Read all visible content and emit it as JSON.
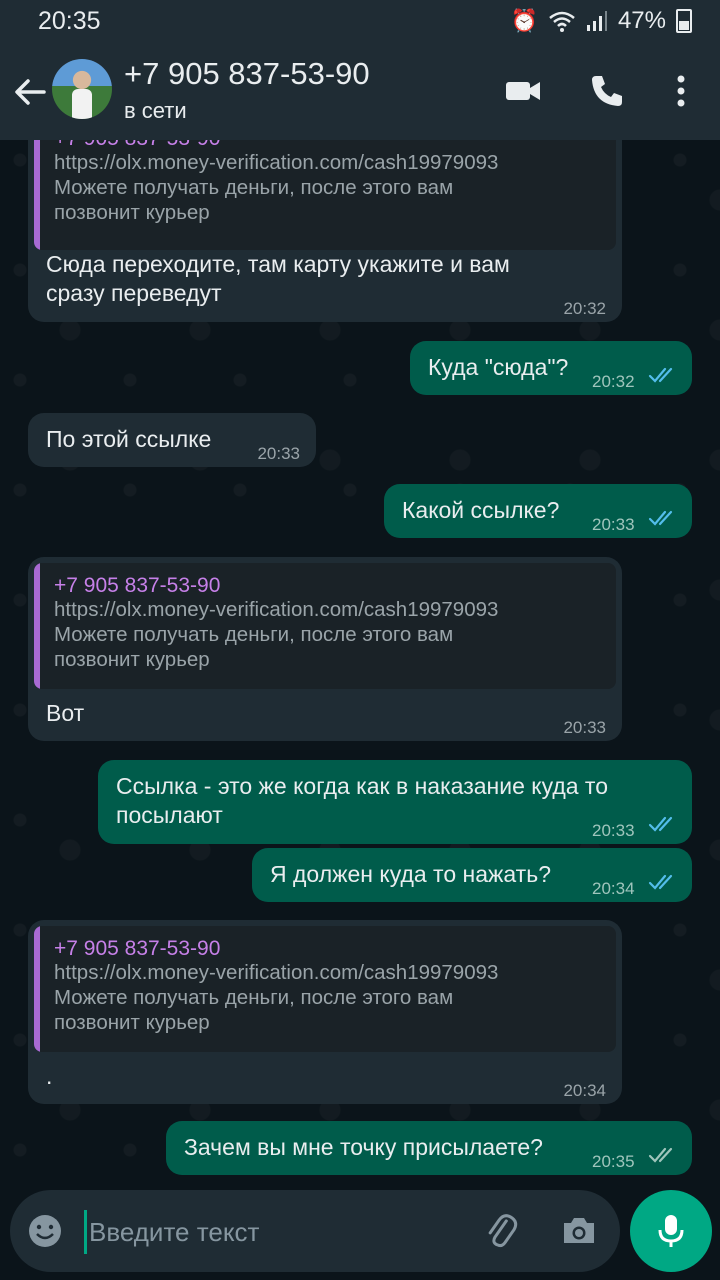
{
  "status_bar": {
    "time": "20:35",
    "battery": "47%"
  },
  "header": {
    "contact_name": "+7 905 837-53-90",
    "status": "в сети"
  },
  "quote": {
    "author": "+7 905 837-53-90",
    "body": "https://olx.money-verification.com/cash19979093\nМожете получать деньги, после этого вам\nпозвонит курьер"
  },
  "messages": [
    {
      "direction": "in",
      "has_quote": true,
      "text": "Сюда переходите, там карту укажите и вам\nсразу переведут",
      "time": "20:32"
    },
    {
      "direction": "out",
      "text": "Куда \"сюда\"?",
      "time": "20:32",
      "read": true
    },
    {
      "direction": "in",
      "text": "По этой ссылке",
      "time": "20:33"
    },
    {
      "direction": "out",
      "text": "Какой ссылке?",
      "time": "20:33",
      "read": true
    },
    {
      "direction": "in",
      "has_quote": true,
      "text": "Вот",
      "time": "20:33"
    },
    {
      "direction": "out",
      "text": "Ссылка - это же когда как в наказание куда то\nпосылают",
      "time": "20:33",
      "read": true
    },
    {
      "direction": "out",
      "text": "Я должен куда то нажать?",
      "time": "20:34",
      "read": true
    },
    {
      "direction": "in",
      "has_quote": true,
      "text": ".",
      "time": "20:34"
    },
    {
      "direction": "out",
      "text": "Зачем вы мне точку присылаете?",
      "time": "20:35",
      "read": false
    }
  ],
  "input": {
    "placeholder": "Введите текст"
  },
  "colors": {
    "header_bg": "#1f2c34",
    "incoming_bubble": "#1f2c34",
    "outgoing_bubble": "#005c4b",
    "accent": "#00a884",
    "read_ticks": "#53bdeb",
    "quote_name": "#c680e8"
  },
  "icons": [
    "back-arrow-icon",
    "video-call-icon",
    "phone-icon",
    "more-vert-icon",
    "emoji-icon",
    "attach-icon",
    "camera-icon",
    "mic-icon",
    "double-tick-icon"
  ]
}
